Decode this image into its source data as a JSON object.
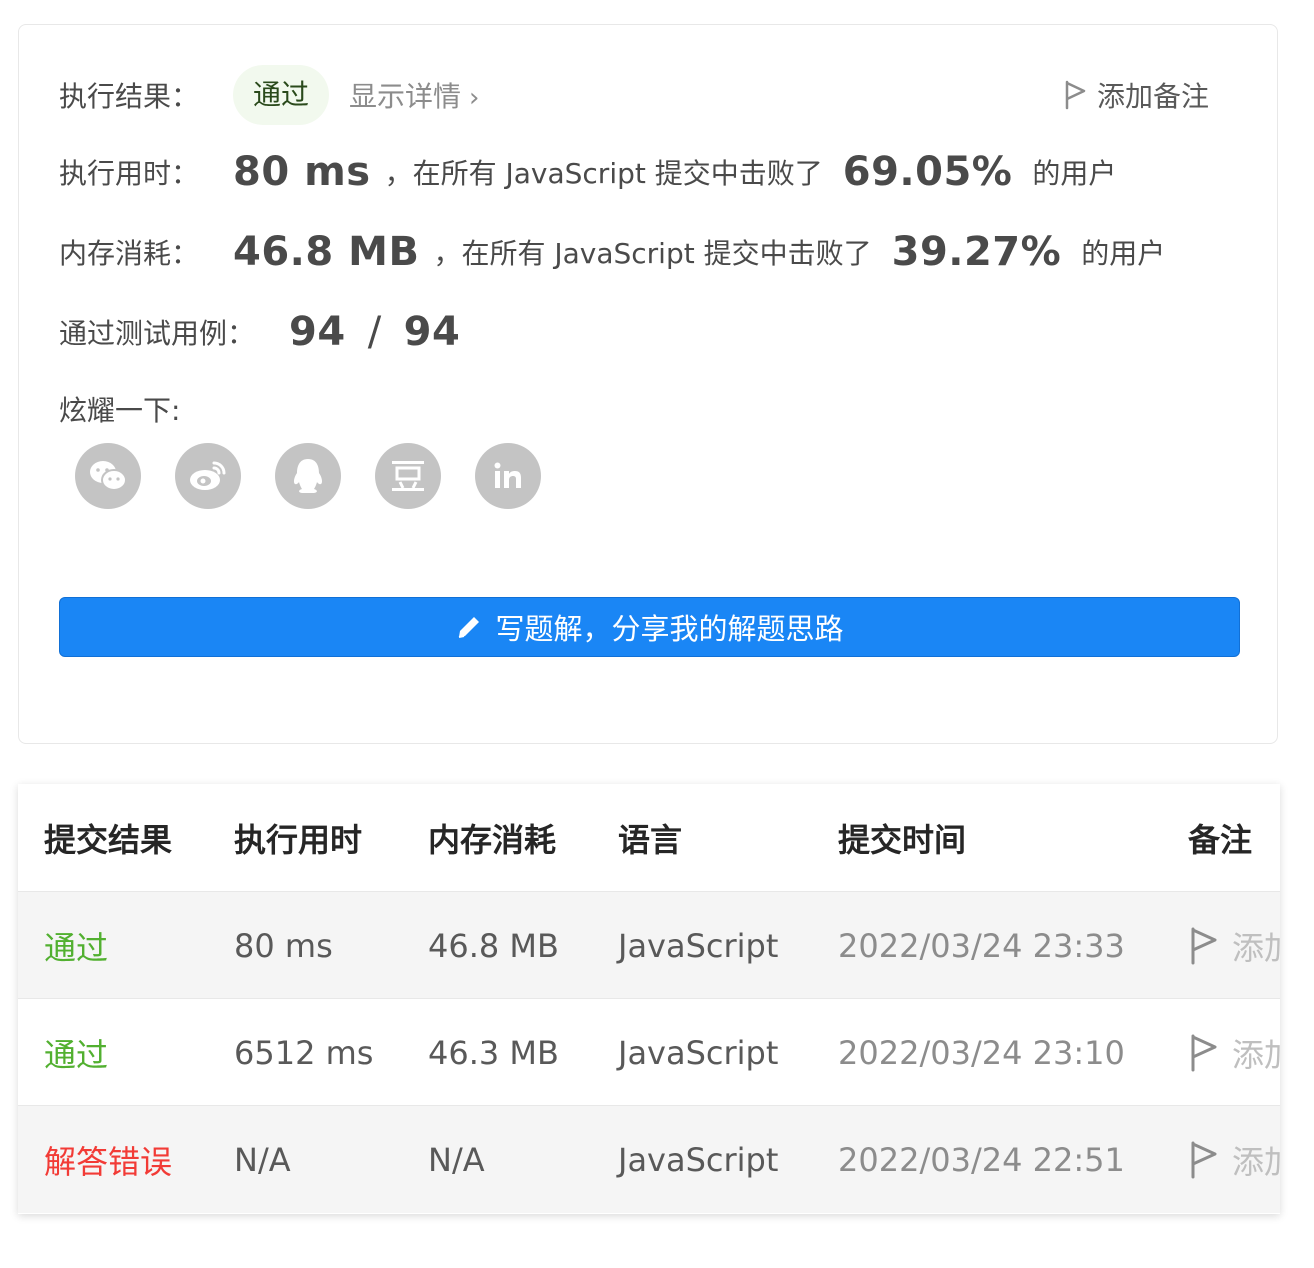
{
  "result": {
    "label": "执行结果：",
    "status": "通过",
    "detail_link": "显示详情",
    "add_note": "添加备注"
  },
  "runtime": {
    "label": "执行用时：",
    "value": "80 ms",
    "mid_text": "，在所有 JavaScript 提交中击败了",
    "percent": "69.05%",
    "suffix": "的用户"
  },
  "memory": {
    "label": "内存消耗：",
    "value": "46.8 MB",
    "mid_text": "，在所有 JavaScript 提交中击败了",
    "percent": "39.27%",
    "suffix": "的用户"
  },
  "testcases": {
    "label": "通过测试用例：",
    "passed": "94",
    "separator": "/",
    "total": "94"
  },
  "share": {
    "label": "炫耀一下:",
    "icons": [
      "wechat-icon",
      "weibo-icon",
      "qq-icon",
      "douban-icon",
      "linkedin-icon"
    ]
  },
  "write_solution": "写题解，分享我的解题思路",
  "table": {
    "headers": [
      "提交结果",
      "执行用时",
      "内存消耗",
      "语言",
      "提交时间",
      "备注"
    ],
    "rows": [
      {
        "status": "通过",
        "status_type": "ok",
        "time": "80 ms",
        "memory": "46.8 MB",
        "lang": "JavaScript",
        "submitted": "2022/03/24 23:33",
        "note": "添加"
      },
      {
        "status": "通过",
        "status_type": "ok",
        "time": "6512 ms",
        "memory": "46.3 MB",
        "lang": "JavaScript",
        "submitted": "2022/03/24 23:10",
        "note": "添加"
      },
      {
        "status": "解答错误",
        "status_type": "error",
        "time": "N/A",
        "memory": "N/A",
        "lang": "JavaScript",
        "submitted": "2022/03/24 22:51",
        "note": "添加"
      }
    ]
  },
  "colors": {
    "accent_blue": "#1a86f5",
    "pass_green": "#52b030",
    "error_red": "#f23b36",
    "icon_gray": "#c4c4c4"
  }
}
